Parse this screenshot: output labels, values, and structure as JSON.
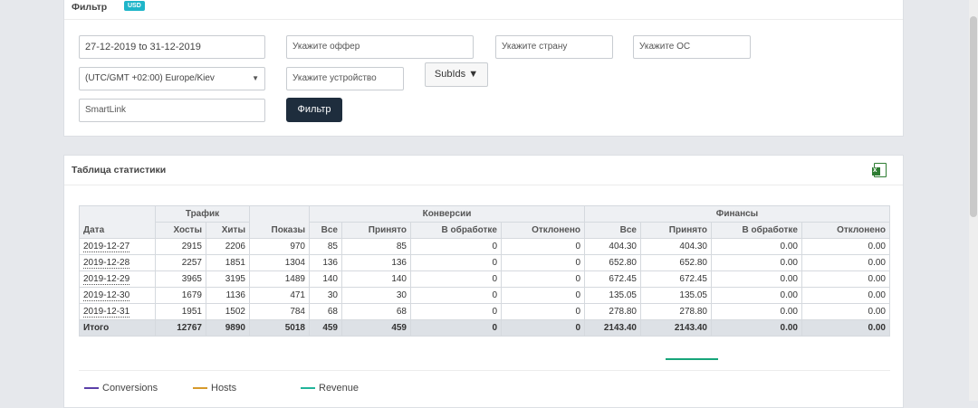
{
  "colors": {
    "page_bg": "#e6e8ec",
    "badge": "#1fb5c9",
    "filter_button": "#1e2d3d",
    "conversions": "#5b3fa8",
    "hosts": "#d79a2b",
    "revenue": "#22b49a"
  },
  "filter": {
    "title": "Фильтр",
    "badge": "USD",
    "date_range": "27-12-2019 to 31-12-2019",
    "offer_placeholder": "Укажите оффер",
    "country_placeholder": "Укажите страну",
    "os_placeholder": "Укажите ОС",
    "timezone": "(UTC/GMT +02:00) Europe/Kiev",
    "device_placeholder": "Укажите устройство",
    "subids_label": "SubIds ▼",
    "smartlink": "SmartLink",
    "submit_label": "Фильтр"
  },
  "stats": {
    "title": "Таблица статистики",
    "export_icon": "excel-icon",
    "groups": {
      "traffic": "Трафик",
      "conversions": "Конверсии",
      "finance": "Финансы"
    },
    "headers": {
      "date": "Дата",
      "hosts": "Хосты",
      "hits": "Хиты",
      "impressions": "Показы",
      "conv_all": "Все",
      "conv_accepted": "Принято",
      "conv_pending": "В обработке",
      "conv_rejected": "Отклонено",
      "fin_all": "Все",
      "fin_accepted": "Принято",
      "fin_pending": "В обработке",
      "fin_rejected": "Отклонено"
    },
    "rows": [
      [
        "2019-12-27",
        "2915",
        "2206",
        "970",
        "85",
        "85",
        "0",
        "0",
        "404.30",
        "404.30",
        "0.00",
        "0.00"
      ],
      [
        "2019-12-28",
        "2257",
        "1851",
        "1304",
        "136",
        "136",
        "0",
        "0",
        "652.80",
        "652.80",
        "0.00",
        "0.00"
      ],
      [
        "2019-12-29",
        "3965",
        "3195",
        "1489",
        "140",
        "140",
        "0",
        "0",
        "672.45",
        "672.45",
        "0.00",
        "0.00"
      ],
      [
        "2019-12-30",
        "1679",
        "1136",
        "471",
        "30",
        "30",
        "0",
        "0",
        "135.05",
        "135.05",
        "0.00",
        "0.00"
      ],
      [
        "2019-12-31",
        "1951",
        "1502",
        "784",
        "68",
        "68",
        "0",
        "0",
        "278.80",
        "278.80",
        "0.00",
        "0.00"
      ]
    ],
    "total": [
      "Итого",
      "12767",
      "9890",
      "5018",
      "459",
      "459",
      "0",
      "0",
      "2143.40",
      "2143.40",
      "0.00",
      "0.00"
    ]
  },
  "legend": {
    "conversions": "Conversions",
    "hosts": "Hosts",
    "revenue": "Revenue"
  }
}
